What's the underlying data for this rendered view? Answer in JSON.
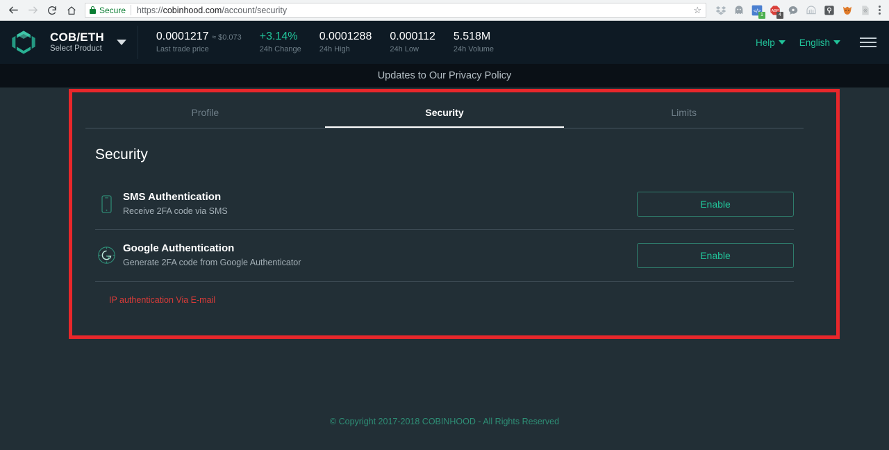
{
  "browser": {
    "back_icon": "back-arrow-icon",
    "forward_icon": "forward-arrow-icon",
    "reload_icon": "reload-icon",
    "home_icon": "home-icon",
    "secure_label": "Secure",
    "url_scheme": "https://",
    "url_host": "cobinhood.com",
    "url_path": "/account/security",
    "bookmark_icon": "star-icon",
    "extensions": [
      {
        "name": "dropbox-extension-icon",
        "color": "#b8c2c9",
        "badge": "",
        "badge_color": ""
      },
      {
        "name": "ghostery-extension-icon",
        "color": "#9aa4ab",
        "badge": "",
        "badge_color": ""
      },
      {
        "name": "code-extension-icon",
        "color": "#4a7fd0",
        "badge": "1",
        "badge_color": "#4caf50"
      },
      {
        "name": "adblock-plus-extension-icon",
        "color": "#d9403a",
        "badge": "4",
        "badge_color": "#555555"
      },
      {
        "name": "chat-extension-icon",
        "color": "#8d979e",
        "badge": "",
        "badge_color": ""
      },
      {
        "name": "wallet-extension-icon",
        "color": "#b5bdc3",
        "badge": "",
        "badge_color": ""
      },
      {
        "name": "keeper-extension-icon",
        "color": "#55595c",
        "badge": "",
        "badge_color": ""
      },
      {
        "name": "fox-extension-icon",
        "color": "#e07b2a",
        "badge": "",
        "badge_color": ""
      },
      {
        "name": "pdf-extension-icon",
        "color": "#b9bdc0",
        "badge": "",
        "badge_color": ""
      }
    ],
    "menu_icon": "three-dot-menu-icon"
  },
  "header": {
    "logo_icon": "cobinhood-logo-icon",
    "pair": "COB/ETH",
    "pair_sub": "Select Product",
    "dropdown_icon": "chevron-down-icon",
    "stats": [
      {
        "value": "0.0001217",
        "approx": "≈ $0.073",
        "label": "Last trade price",
        "color": "#ffffff"
      },
      {
        "value": "+3.14%",
        "approx": "",
        "label": "24h Change",
        "color": "#21c49a"
      },
      {
        "value": "0.0001288",
        "approx": "",
        "label": "24h High",
        "color": "#ffffff"
      },
      {
        "value": "0.000112",
        "approx": "",
        "label": "24h Low",
        "color": "#ffffff"
      },
      {
        "value": "5.518M",
        "approx": "",
        "label": "24h Volume",
        "color": "#ffffff"
      }
    ],
    "help_label": "Help",
    "language_label": "English",
    "menu_icon": "hamburger-menu-icon"
  },
  "banner": {
    "text": "Updates to Our Privacy Policy"
  },
  "account": {
    "tabs": [
      {
        "label": "Profile",
        "active": false
      },
      {
        "label": "Security",
        "active": true
      },
      {
        "label": "Limits",
        "active": false
      }
    ],
    "section_title": "Security",
    "methods": [
      {
        "icon": "phone-icon",
        "title": "SMS Authentication",
        "description": "Receive 2FA code via SMS",
        "button_label": "Enable"
      },
      {
        "icon": "google-authenticator-icon",
        "title": "Google Authentication",
        "description": "Generate 2FA code from Google Authenticator",
        "button_label": "Enable"
      }
    ],
    "ip_link_label": "IP authentication Via E-mail"
  },
  "footer": {
    "copyright": "© Copyright 2017-2018 COBINHOOD - All Rights Reserved"
  },
  "annotation": {
    "color": "#e8272b"
  }
}
